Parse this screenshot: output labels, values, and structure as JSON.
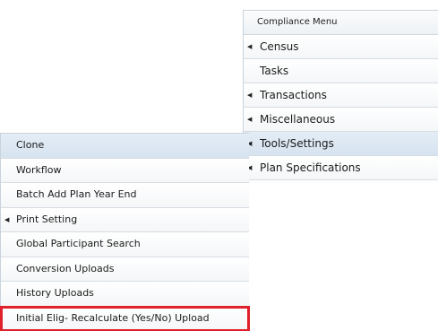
{
  "compliance_menu": {
    "header": "Compliance Menu",
    "items": [
      {
        "label": "Census",
        "has_submenu": true
      },
      {
        "label": "Tasks",
        "has_submenu": false
      },
      {
        "label": "Transactions",
        "has_submenu": true
      },
      {
        "label": "Miscellaneous",
        "has_submenu": true
      },
      {
        "label": "Tools/Settings",
        "has_submenu": true,
        "active": true
      },
      {
        "label": "Plan Specifications",
        "has_submenu": true
      }
    ]
  },
  "tools_settings_submenu": {
    "items": [
      {
        "label": "Clone",
        "has_submenu": false,
        "active": true
      },
      {
        "label": "Workflow",
        "has_submenu": false
      },
      {
        "label": "Batch Add Plan Year End",
        "has_submenu": false
      },
      {
        "label": "Print Setting",
        "has_submenu": true
      },
      {
        "label": "Global Participant Search",
        "has_submenu": false
      },
      {
        "label": "Conversion Uploads",
        "has_submenu": false
      },
      {
        "label": "History Uploads",
        "has_submenu": false
      },
      {
        "label": "Initial Elig- Recalculate (Yes/No) Upload",
        "has_submenu": false,
        "highlighted": true
      }
    ]
  },
  "icons": {
    "submenu_arrow": "chevron-left-icon",
    "highlight_color": "#e0202a"
  }
}
